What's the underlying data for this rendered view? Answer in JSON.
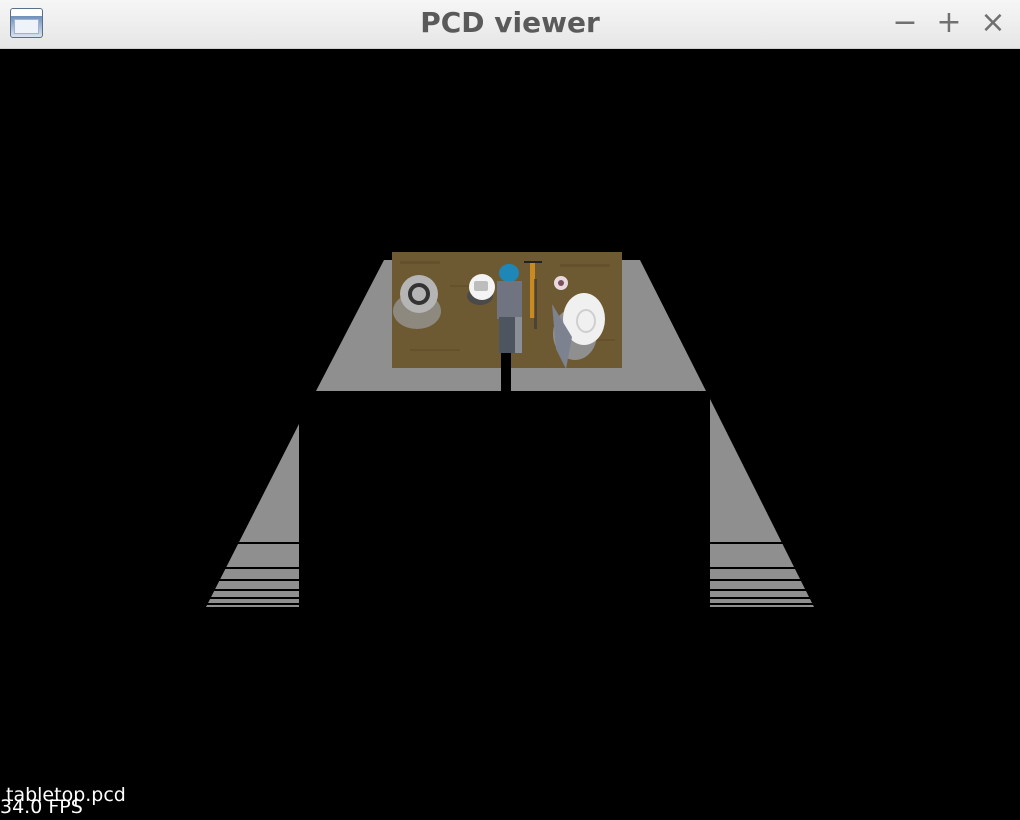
{
  "window": {
    "title": "PCD viewer",
    "minimize_glyph": "−",
    "maximize_glyph": "+",
    "close_glyph": "×",
    "app_icon": "window-app-icon"
  },
  "viewer": {
    "background_color": "#000000",
    "cloud_color": "#8f8f8f",
    "table_color": "#6e5a32",
    "overlay": {
      "filename": "tabletop.pcd",
      "fps": "34.0 FPS"
    }
  }
}
